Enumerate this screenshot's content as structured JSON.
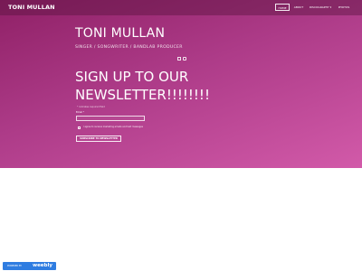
{
  "header": {
    "site_title": "TONI MULLAN",
    "nav": [
      "HOME",
      "ABOUT",
      "DISCOGRAPHY ▾",
      "PHOTOS"
    ]
  },
  "hero": {
    "artist_name": "TONI MULLAN",
    "tagline": "SINGER / SONGWRITER / BANDLAB PRODUCER",
    "social_icons": [
      "facebook-icon",
      "youtube-icon"
    ],
    "heading_line1": "SIGN UP TO OUR",
    "heading_line2": "NEWSLETTER!!!!!!!!",
    "form_note": "* indicates required field",
    "email_label": "Email *",
    "consent_text": "I agree to receive marketing emails and text messages",
    "subscribe_label": "SUBSCRIBE TO NEWSLETTER"
  },
  "footer": {
    "badge_prefix": "POWERED BY",
    "badge_logo": "weebly"
  },
  "colors": {
    "hero_start": "#8f2066",
    "hero_end": "#d25aa9",
    "badge": "#2f7de1"
  }
}
